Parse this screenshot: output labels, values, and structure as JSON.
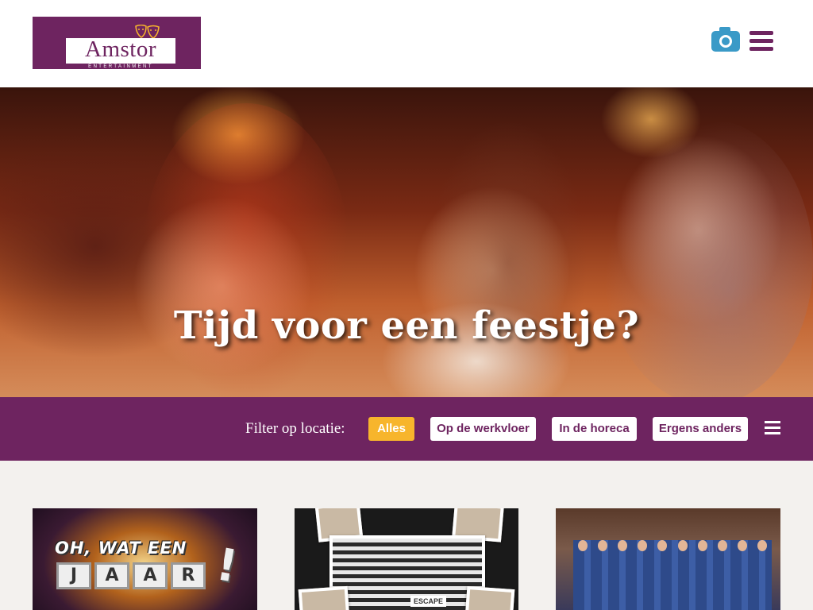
{
  "header": {
    "logo_text": "Amstor",
    "logo_subtext": "ENTERTAINMENT",
    "camera_icon": "camera-icon",
    "menu_icon": "hamburger-menu-icon"
  },
  "hero": {
    "title": "Tijd voor een feestje?"
  },
  "filter": {
    "label": "Filter op locatie:",
    "options": [
      {
        "label": "Alles",
        "active": true
      },
      {
        "label": "Op de werkvloer",
        "active": false
      },
      {
        "label": "In de horeca",
        "active": false
      },
      {
        "label": "Ergens anders",
        "active": false
      }
    ],
    "menu_icon": "list-menu-icon"
  },
  "cards": [
    {
      "title_line1": "OH, WAT EEN",
      "title_letters": [
        "J",
        "A",
        "A",
        "R"
      ],
      "exclamation": "!"
    },
    {
      "badge": "ESCAPE"
    },
    {}
  ],
  "colors": {
    "brand_purple": "#6e2460",
    "accent_yellow": "#f7b52c",
    "camera_blue": "#3a9ac7"
  }
}
